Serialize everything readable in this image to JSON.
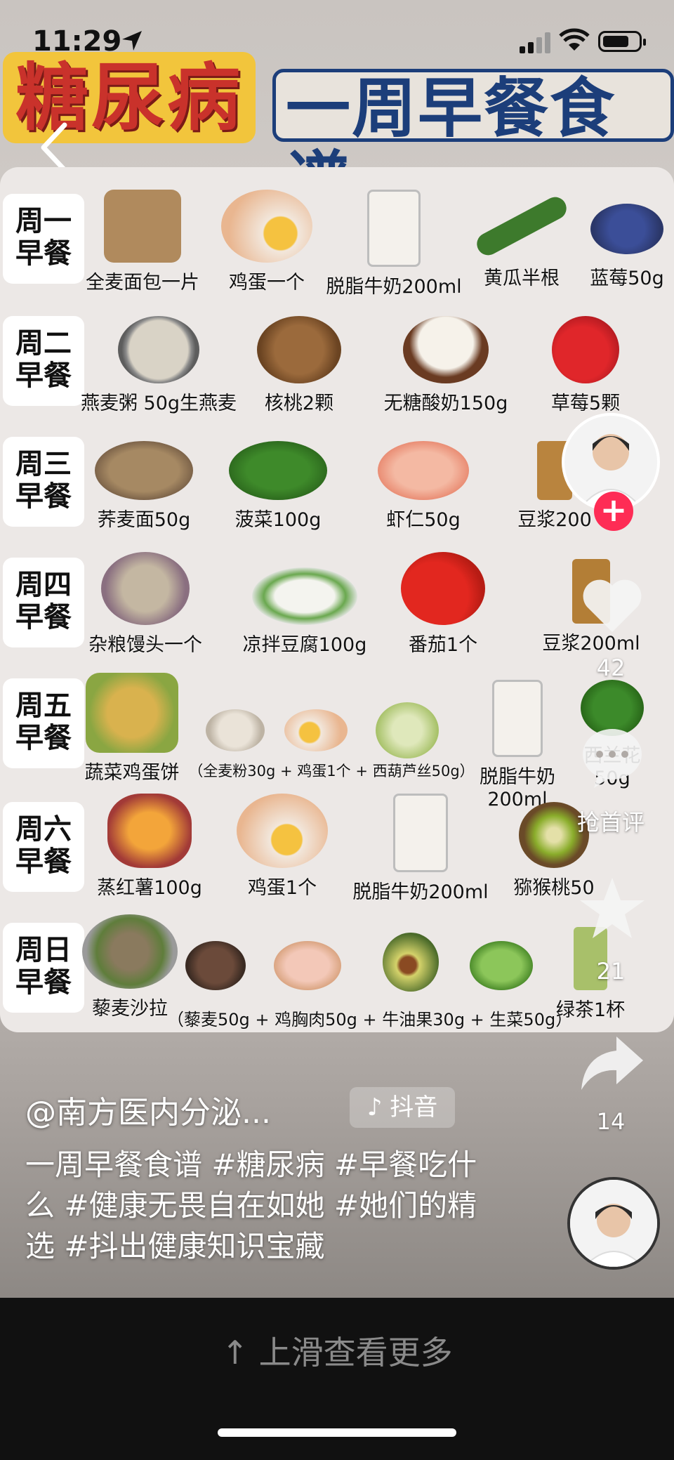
{
  "status": {
    "time": "11:29"
  },
  "title": {
    "left": "糖尿病",
    "right": "一周早餐食谱"
  },
  "rows": [
    {
      "day": "周一\n早餐",
      "day_a": "周一",
      "day_b": "早餐",
      "foods": [
        "全麦面包一片",
        "鸡蛋一个",
        "脱脂牛奶200ml",
        "黄瓜半根",
        "蓝莓50g"
      ]
    },
    {
      "day_a": "周二",
      "day_b": "早餐",
      "foods": [
        "燕麦粥 50g生燕麦",
        "核桃2颗",
        "无糖酸奶150g",
        "草莓5颗"
      ]
    },
    {
      "day_a": "周三",
      "day_b": "早餐",
      "foods": [
        "荞麦面50g",
        "菠菜100g",
        "虾仁50g",
        "豆浆200"
      ]
    },
    {
      "day_a": "周四",
      "day_b": "早餐",
      "foods": [
        "杂粮馒头一个",
        "凉拌豆腐100g",
        "番茄1个",
        "豆浆200ml"
      ]
    },
    {
      "day_a": "周五",
      "day_b": "早餐",
      "foods": [
        "蔬菜鸡蛋饼",
        "（全麦粉30g + 鸡蛋1个 + 西葫芦丝50g）",
        "脱脂牛奶",
        "200ml",
        "西兰花",
        "50g"
      ]
    },
    {
      "day_a": "周六",
      "day_b": "早餐",
      "foods": [
        "蒸红薯100g",
        "鸡蛋1个",
        "脱脂牛奶200ml",
        "猕猴桃50"
      ]
    },
    {
      "day_a": "周日",
      "day_b": "早餐",
      "foods": [
        "藜麦沙拉",
        "（藜麦50g + 鸡胸肉50g + 牛油果30g + 生菜50g）",
        "绿茶1杯"
      ]
    }
  ],
  "sidebar": {
    "likes": "42",
    "comment_label": "抢首评",
    "favorites": "21",
    "shares": "14"
  },
  "caption": {
    "user": "@南方医内分泌...",
    "badge": "抖音",
    "text": "一周早餐食谱 #糖尿病  #早餐吃什么  #健康无畏自在如她  #她们的精选  #抖出健康知识宝藏"
  },
  "bottom": {
    "more": "上滑查看更多"
  },
  "colors": {
    "accent": "#fe2c55",
    "title_red": "#c9322b",
    "title_blue": "#1c3e7a"
  }
}
